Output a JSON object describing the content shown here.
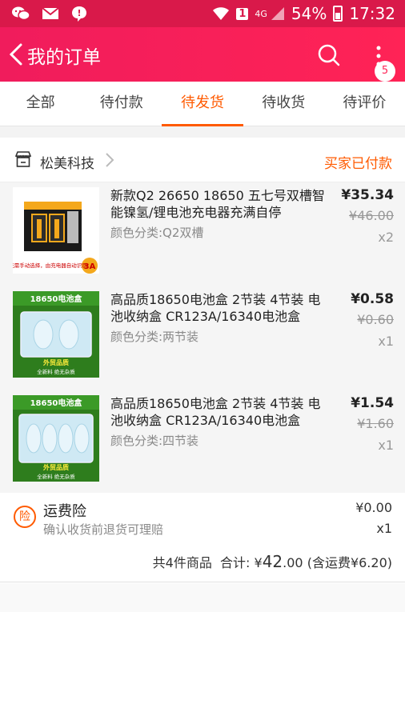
{
  "status_bar": {
    "network": "4G",
    "battery": "54%",
    "time": "17:32"
  },
  "nav": {
    "title": "我的订单",
    "badge": "5"
  },
  "tabs": [
    {
      "label": "全部"
    },
    {
      "label": "待付款"
    },
    {
      "label": "待发货",
      "active": true
    },
    {
      "label": "待收货"
    },
    {
      "label": "待评价"
    }
  ],
  "shop": {
    "name": "松美科技",
    "status": "买家已付款"
  },
  "items": [
    {
      "title": "新款Q2 26650 18650 五七号双槽智能镍氢/锂电池充电器充满自停",
      "attr": "颜色分类:Q2双槽",
      "price": "¥35.34",
      "original_price": "¥46.00",
      "qty": "x2",
      "image_label": "3A",
      "image_caption": "无需手动选择，由充电器自动识别"
    },
    {
      "title": "高品质18650电池盒 2节装 4节装 电池收纳盒 CR123A/16340电池盒",
      "attr": "颜色分类:两节装",
      "price": "¥0.58",
      "original_price": "¥0.60",
      "qty": "x1",
      "image_label": "18650电池盒",
      "image_caption_1": "外贸品质",
      "image_caption_2": "全新料 绝无杂质"
    },
    {
      "title": "高品质18650电池盒 2节装 4节装 电池收纳盒 CR123A/16340电池盒",
      "attr": "颜色分类:四节装",
      "price": "¥1.54",
      "original_price": "¥1.60",
      "qty": "x1",
      "image_label": "18650电池盒",
      "image_caption_1": "外贸品质",
      "image_caption_2": "全新料 绝无杂质"
    }
  ],
  "insurance": {
    "icon_text": "险",
    "title": "运费险",
    "desc": "确认收货前退货可理赔",
    "price": "¥0.00",
    "qty": "x1"
  },
  "summary": {
    "count_text": "共4件商品",
    "total_label": "合计:",
    "currency": "¥",
    "total_big": "42",
    "total_small": ".00",
    "shipping_text": "(含运费¥6.20)"
  },
  "colors": {
    "brand": "#ff2356",
    "accent": "#ff5a00"
  }
}
